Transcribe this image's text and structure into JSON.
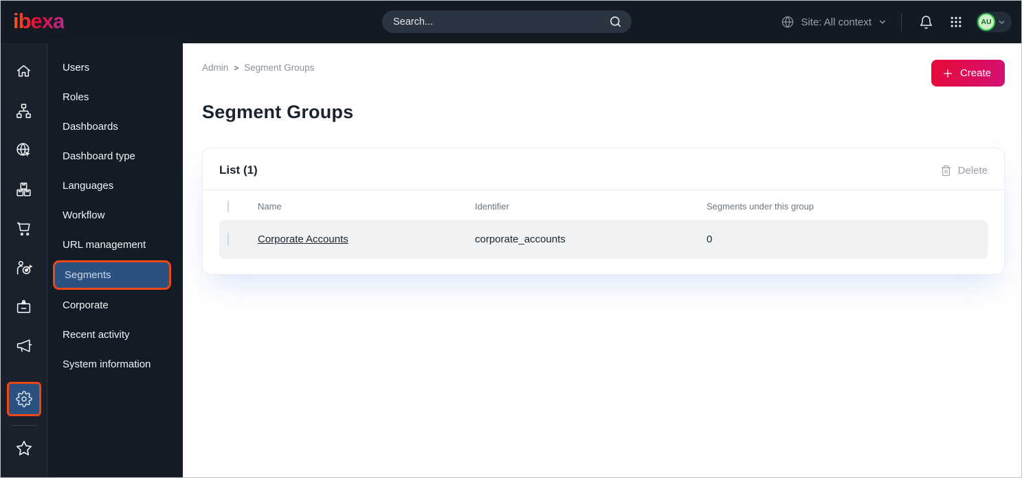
{
  "topbar": {
    "logo_text": "ibexa",
    "search_placeholder": "Search...",
    "site_context_label": "Site: All context",
    "avatar_initials": "AU"
  },
  "icon_rail": {
    "items": [
      "home",
      "site-structure",
      "site",
      "products",
      "commerce",
      "personalization",
      "corporate",
      "campaign"
    ],
    "bottom_items": [
      "settings",
      "bookmarks"
    ],
    "selected": "settings"
  },
  "sidebar": {
    "items": [
      {
        "label": "Users",
        "selected": false
      },
      {
        "label": "Roles",
        "selected": false
      },
      {
        "label": "Dashboards",
        "selected": false
      },
      {
        "label": "Dashboard type",
        "selected": false
      },
      {
        "label": "Languages",
        "selected": false
      },
      {
        "label": "Workflow",
        "selected": false
      },
      {
        "label": "URL management",
        "selected": false
      },
      {
        "label": "Segments",
        "selected": true
      },
      {
        "label": "Corporate",
        "selected": false
      },
      {
        "label": "Recent activity",
        "selected": false
      },
      {
        "label": "System information",
        "selected": false
      }
    ]
  },
  "main": {
    "breadcrumb": [
      "Admin",
      "Segment Groups"
    ],
    "title": "Segment Groups",
    "create_label": "Create",
    "list": {
      "title": "List (1)",
      "delete_label": "Delete",
      "columns": [
        "Name",
        "Identifier",
        "Segments under this group"
      ],
      "rows": [
        {
          "name": "Corporate Accounts",
          "identifier": "corporate_accounts",
          "segments_count": "0"
        }
      ]
    }
  },
  "colors": {
    "topbar_bg": "#121a24",
    "sidebar_bg": "#131b26",
    "selected_blue": "#2b5181",
    "highlight_orange": "#ee4713",
    "brand_gradient_start": "#e60b3c",
    "brand_gradient_end": "#d41070",
    "avatar_green": "#35c24d",
    "row_bg": "#f1f2f4"
  }
}
